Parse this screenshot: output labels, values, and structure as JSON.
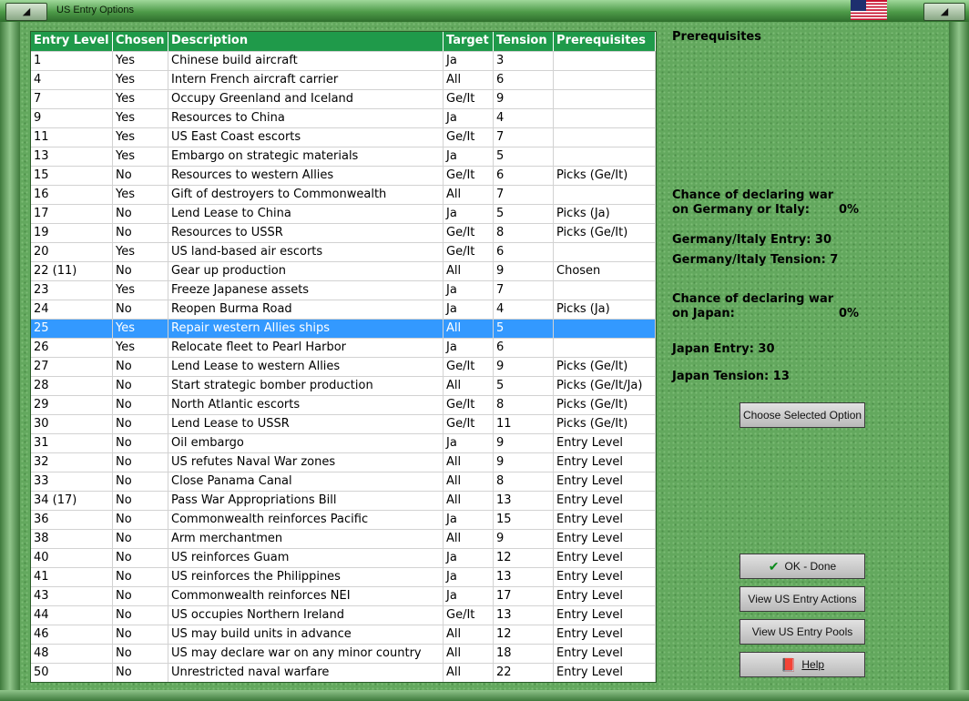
{
  "window": {
    "title": "US Entry Options",
    "left_btn": "◢",
    "right_btn": "◢",
    "flag": "us-flag"
  },
  "table": {
    "headers": [
      "Entry Level",
      "Chosen",
      "Description",
      "Target",
      "Tension",
      "Prerequisites"
    ],
    "rows": [
      [
        "1",
        "Yes",
        "Chinese build aircraft",
        "Ja",
        "3",
        ""
      ],
      [
        "4",
        "Yes",
        "Intern French aircraft carrier",
        "All",
        "6",
        ""
      ],
      [
        "7",
        "Yes",
        "Occupy Greenland and Iceland",
        "Ge/It",
        "9",
        ""
      ],
      [
        "9",
        "Yes",
        "Resources to China",
        "Ja",
        "4",
        ""
      ],
      [
        "11",
        "Yes",
        "US East Coast escorts",
        "Ge/It",
        "7",
        ""
      ],
      [
        "13",
        "Yes",
        "Embargo on strategic materials",
        "Ja",
        "5",
        ""
      ],
      [
        "15",
        "No",
        "Resources to western Allies",
        "Ge/It",
        "6",
        "Picks (Ge/It)"
      ],
      [
        "16",
        "Yes",
        "Gift of destroyers to Commonwealth",
        "All",
        "7",
        ""
      ],
      [
        "17",
        "No",
        "Lend Lease to China",
        "Ja",
        "5",
        "Picks (Ja)"
      ],
      [
        "19",
        "No",
        "Resources to USSR",
        "Ge/It",
        "8",
        "Picks (Ge/It)"
      ],
      [
        "20",
        "Yes",
        "US land-based air escorts",
        "Ge/It",
        "6",
        ""
      ],
      [
        "22 (11)",
        "No",
        "Gear up production",
        "All",
        "9",
        "Chosen"
      ],
      [
        "23",
        "Yes",
        "Freeze Japanese assets",
        "Ja",
        "7",
        ""
      ],
      [
        "24",
        "No",
        "Reopen Burma Road",
        "Ja",
        "4",
        "Picks (Ja)"
      ],
      [
        "25",
        "Yes",
        "Repair western Allies ships",
        "All",
        "5",
        ""
      ],
      [
        "26",
        "Yes",
        "Relocate fleet to Pearl Harbor",
        "Ja",
        "6",
        ""
      ],
      [
        "27",
        "No",
        "Lend Lease to western Allies",
        "Ge/It",
        "9",
        "Picks (Ge/It)"
      ],
      [
        "28",
        "No",
        "Start strategic bomber production",
        "All",
        "5",
        "Picks (Ge/It/Ja)"
      ],
      [
        "29",
        "No",
        "North Atlantic escorts",
        "Ge/It",
        "8",
        "Picks (Ge/It)"
      ],
      [
        "30",
        "No",
        "Lend Lease to USSR",
        "Ge/It",
        "11",
        "Picks (Ge/It)"
      ],
      [
        "31",
        "No",
        "Oil embargo",
        "Ja",
        "9",
        "Entry Level"
      ],
      [
        "32",
        "No",
        "US refutes Naval War zones",
        "All",
        "9",
        "Entry Level"
      ],
      [
        "33",
        "No",
        "Close Panama Canal",
        "All",
        "8",
        "Entry Level"
      ],
      [
        "34 (17)",
        "No",
        "Pass War Appropriations Bill",
        "All",
        "13",
        "Entry Level"
      ],
      [
        "36",
        "No",
        "Commonwealth reinforces Pacific",
        "Ja",
        "15",
        "Entry Level"
      ],
      [
        "38",
        "No",
        "Arm merchantmen",
        "All",
        "9",
        "Entry Level"
      ],
      [
        "40",
        "No",
        "US reinforces Guam",
        "Ja",
        "12",
        "Entry Level"
      ],
      [
        "41",
        "No",
        "US reinforces the Philippines",
        "Ja",
        "13",
        "Entry Level"
      ],
      [
        "43",
        "No",
        "Commonwealth reinforces NEI",
        "Ja",
        "17",
        "Entry Level"
      ],
      [
        "44",
        "No",
        "US occupies Northern Ireland",
        "Ge/It",
        "13",
        "Entry Level"
      ],
      [
        "46",
        "No",
        "US may build units in advance",
        "All",
        "12",
        "Entry Level"
      ],
      [
        "48",
        "No",
        "US may declare war on any minor country",
        "All",
        "18",
        "Entry Level"
      ],
      [
        "50",
        "No",
        "Unrestricted naval warfare",
        "All",
        "22",
        "Entry Level"
      ]
    ],
    "selected_index": 14
  },
  "panel": {
    "prereq_title": "Prerequisites",
    "chance_ge_line1": "Chance of declaring war",
    "chance_ge_line2": "on Germany or Italy:",
    "chance_ge_value": "0%",
    "ge_entry": "Germany/Italy Entry: 30",
    "ge_tension": "Germany/Italy Tension: 7",
    "chance_ja_line1": "Chance of declaring war",
    "chance_ja_line2": "on Japan:",
    "chance_ja_value": "0%",
    "ja_entry": "Japan Entry: 30",
    "ja_tension": "Japan Tension: 13",
    "choose_btn": "Choose Selected Option",
    "ok_btn": "OK - Done",
    "actions_btn": "View US Entry Actions",
    "pools_btn": "View US Entry Pools",
    "help_btn": "Help"
  },
  "colors": {
    "header_bg": "#1f9a4a",
    "selected_bg": "#3399ff"
  }
}
